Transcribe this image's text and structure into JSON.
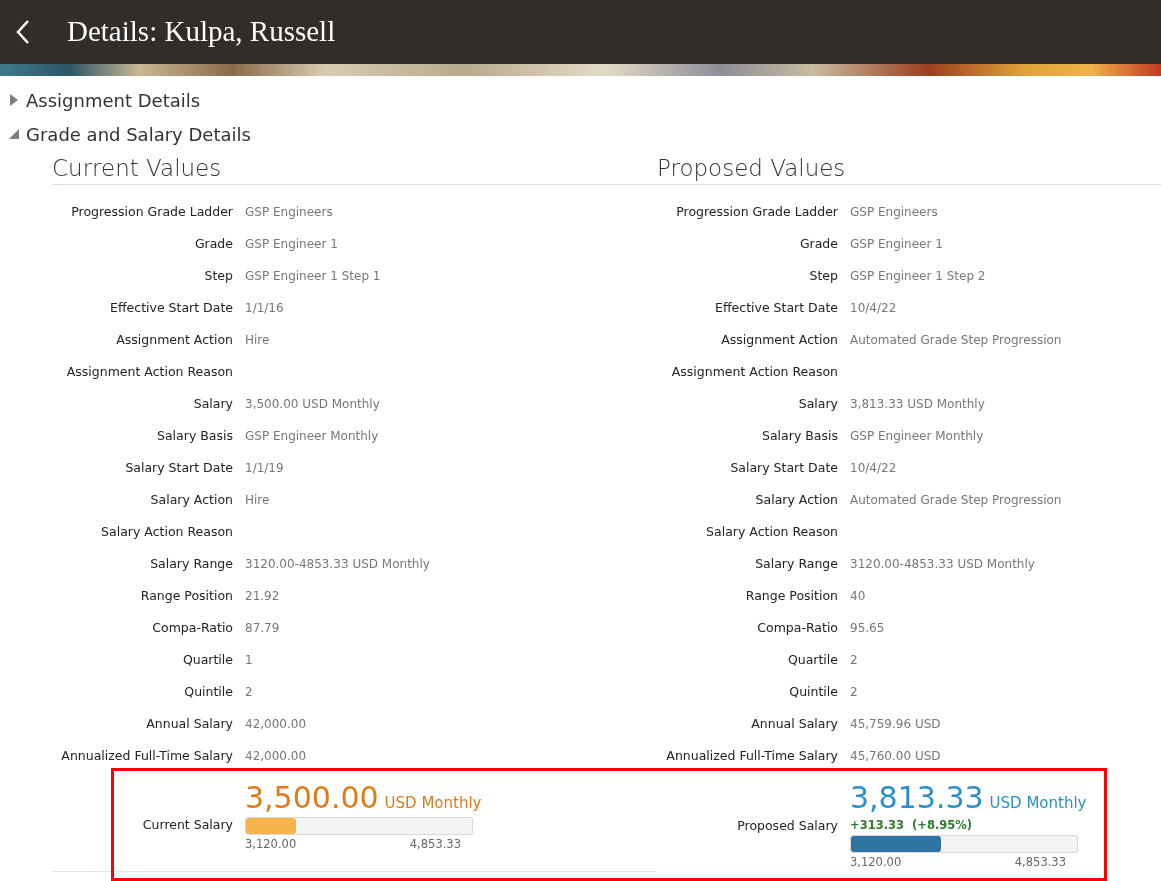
{
  "header": {
    "title": "Details: Kulpa, Russell"
  },
  "sections": [
    {
      "title": "Assignment Details",
      "expanded": false
    },
    {
      "title": "Grade and Salary Details",
      "expanded": true
    }
  ],
  "columns": [
    {
      "title": "Current Values",
      "fields": [
        {
          "label": "Progression Grade Ladder",
          "value": "GSP Engineers"
        },
        {
          "label": "Grade",
          "value": "GSP Engineer 1"
        },
        {
          "label": "Step",
          "value": "GSP Engineer 1 Step 1"
        },
        {
          "label": "Effective Start Date",
          "value": "1/1/16"
        },
        {
          "label": "Assignment Action",
          "value": "Hire"
        },
        {
          "label": "Assignment Action Reason"
        },
        {
          "label": "Salary",
          "value": "3,500.00 USD Monthly"
        },
        {
          "label": "Salary Basis",
          "value": "GSP Engineer Monthly"
        },
        {
          "label": "Salary Start Date",
          "value": "1/1/19"
        },
        {
          "label": "Salary Action",
          "value": "Hire"
        },
        {
          "label": "Salary Action Reason"
        },
        {
          "label": "Salary Range",
          "value": "3120.00-4853.33 USD Monthly"
        },
        {
          "label": "Range Position",
          "value": "21.92"
        },
        {
          "label": "Compa-Ratio",
          "value": "87.79"
        },
        {
          "label": "Quartile",
          "value": "1"
        },
        {
          "label": "Quintile",
          "value": "2"
        },
        {
          "label": "Annual Salary",
          "value": "42,000.00"
        },
        {
          "label": "Annualized Full-Time Salary",
          "value": "42,000.00"
        }
      ],
      "summary": {
        "kind": "current",
        "label": "Current Salary",
        "amount": "3,500.00",
        "unit": "USD Monthly",
        "level": 0.22,
        "min": "3,120.00",
        "max": "4,853.33"
      }
    },
    {
      "title": "Proposed Values",
      "fields": [
        {
          "label": "Progression Grade Ladder",
          "value": "GSP Engineers"
        },
        {
          "label": "Grade",
          "value": "GSP Engineer 1"
        },
        {
          "label": "Step",
          "value": "GSP Engineer 1 Step 2"
        },
        {
          "label": "Effective Start Date",
          "value": "10/4/22"
        },
        {
          "label": "Assignment Action",
          "value": "Automated Grade Step Progression"
        },
        {
          "label": "Assignment Action Reason"
        },
        {
          "label": "Salary",
          "value": "3,813.33 USD Monthly"
        },
        {
          "label": "Salary Basis",
          "value": "GSP Engineer Monthly"
        },
        {
          "label": "Salary Start Date",
          "value": "10/4/22"
        },
        {
          "label": "Salary Action",
          "value": "Automated Grade Step Progression"
        },
        {
          "label": "Salary Action Reason"
        },
        {
          "label": "Salary Range",
          "value": "3120.00-4853.33 USD Monthly"
        },
        {
          "label": "Range Position",
          "value": "40"
        },
        {
          "label": "Compa-Ratio",
          "value": "95.65"
        },
        {
          "label": "Quartile",
          "value": "2"
        },
        {
          "label": "Quintile",
          "value": "2"
        },
        {
          "label": "Annual Salary",
          "value": "45,759.96 USD"
        },
        {
          "label": "Annualized Full-Time Salary",
          "value": "45,760.00 USD"
        }
      ],
      "summary": {
        "kind": "proposed",
        "label": "Proposed Salary",
        "amount": "3,813.33",
        "unit": "USD Monthly",
        "change": "+313.33  (+8.95%)",
        "level": 0.4,
        "min": "3,120.00",
        "max": "4,853.33"
      }
    }
  ],
  "highlight": true
}
